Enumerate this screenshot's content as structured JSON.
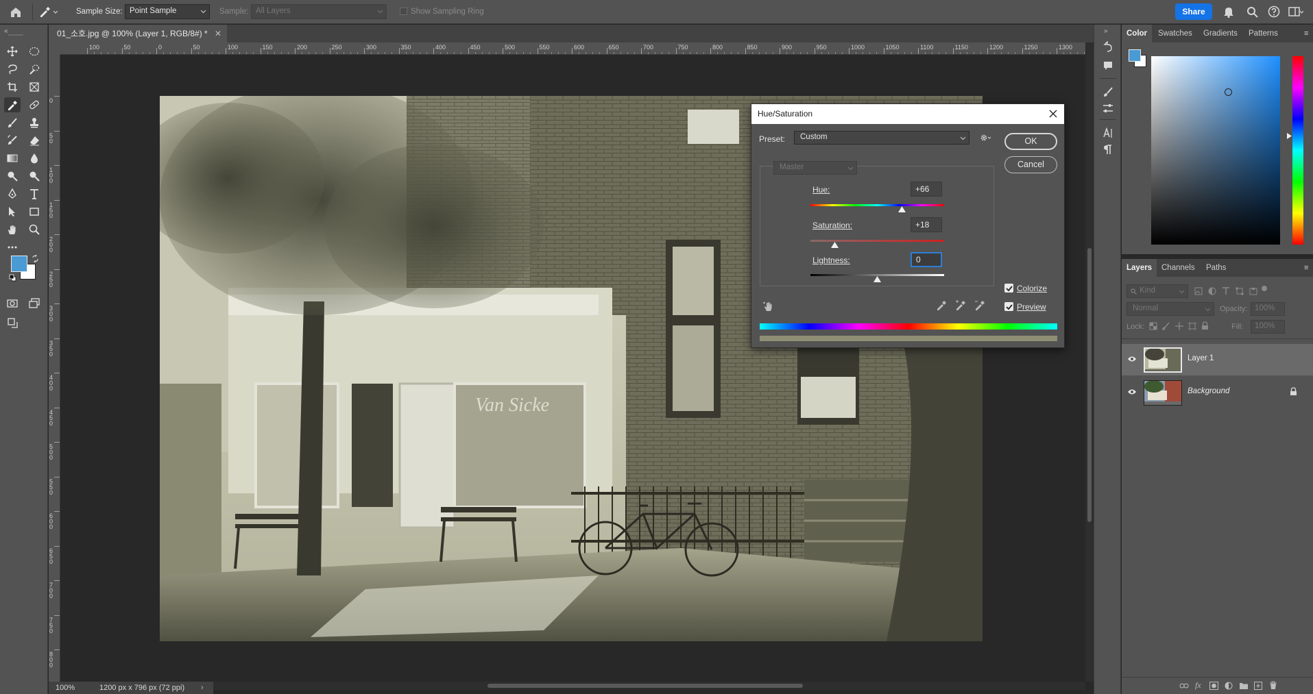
{
  "options_bar": {
    "sample_size_label": "Sample Size:",
    "sample_size_value": "Point Sample",
    "sample_label": "Sample:",
    "sample_value": "All Layers",
    "sampling_ring_label": "Show Sampling Ring",
    "share_label": "Share"
  },
  "document": {
    "tab_title": "01_소호.jpg @ 100% (Layer 1, RGB/8#) *",
    "zoom": "100%",
    "dimensions": "1200 px x 796 px (72 ppi)"
  },
  "rulers": {
    "horizontal_ticks": [
      "100",
      "50",
      "0",
      "50",
      "100",
      "150",
      "200",
      "250",
      "300",
      "350",
      "400",
      "450",
      "500",
      "550",
      "600",
      "650",
      "700",
      "750",
      "800",
      "850",
      "900",
      "950",
      "1000",
      "1050",
      "1100",
      "1150",
      "1200",
      "1250",
      "1300"
    ],
    "vertical_ticks": [
      "0",
      "50",
      "100",
      "150",
      "200",
      "250",
      "300",
      "350",
      "400",
      "450",
      "500",
      "550",
      "600",
      "650",
      "700",
      "750",
      "800"
    ]
  },
  "dialog": {
    "title": "Hue/Saturation",
    "preset_label": "Preset:",
    "preset_value": "Custom",
    "channel_value": "Master",
    "hue_label": "Hue:",
    "hue_value": "+66",
    "saturation_label": "Saturation:",
    "saturation_value": "+18",
    "lightness_label": "Lightness:",
    "lightness_value": "0",
    "ok_label": "OK",
    "cancel_label": "Cancel",
    "colorize_label": "Colorize",
    "colorize_checked": true,
    "preview_label": "Preview",
    "preview_checked": true,
    "hue_slider_fraction": 0.683,
    "saturation_slider_fraction": 0.18,
    "lightness_slider_fraction": 0.5
  },
  "color_panel": {
    "tabs": [
      "Color",
      "Swatches",
      "Gradients",
      "Patterns"
    ],
    "foreground": "#4a9ad4",
    "background": "#ffffff"
  },
  "layers_panel": {
    "tabs": [
      "Layers",
      "Channels",
      "Paths"
    ],
    "filter_label": "Kind",
    "blend_mode": "Normal",
    "opacity_label": "Opacity:",
    "opacity_value": "100%",
    "lock_label": "Lock:",
    "fill_label": "Fill:",
    "fill_value": "100%",
    "layers": [
      {
        "name": "Layer 1",
        "selected": true
      },
      {
        "name": "Background",
        "selected": false
      }
    ]
  },
  "colors": {
    "accent": "#1473e6",
    "focus_ring": "#2d7fd6",
    "sepia_tint": "#8e8e74"
  }
}
